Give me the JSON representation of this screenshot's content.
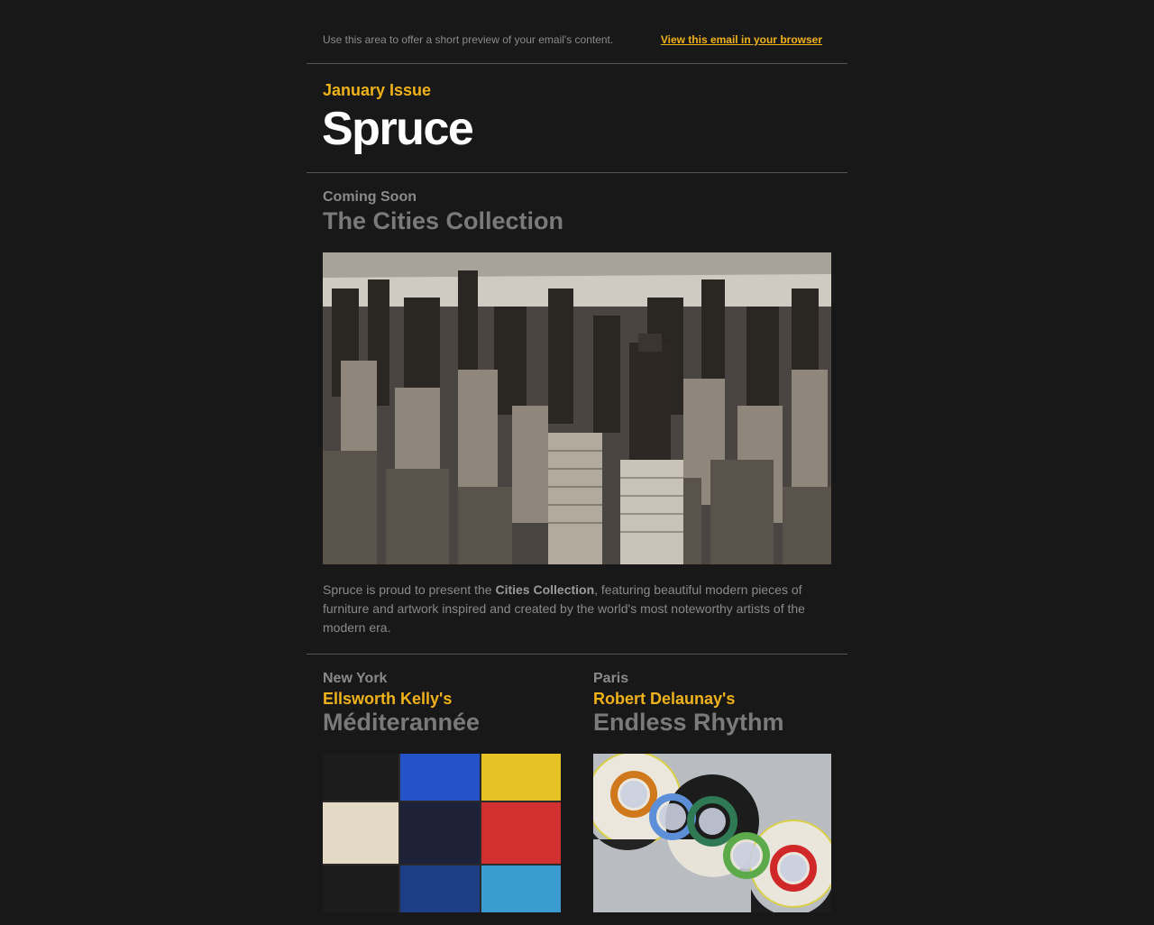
{
  "preheader": {
    "text": "Use this area to offer a short preview of your email's content.",
    "browser_link": "View this email in your browser"
  },
  "header": {
    "issue": "January Issue",
    "brand": "Spruce"
  },
  "feature": {
    "kicker": "Coming Soon",
    "title": "The Cities Collection",
    "body_before": "Spruce is proud to present the ",
    "body_bold": "Cities Collection",
    "body_after": ", featuring beautiful modern pieces of furniture and artwork inspired and created by the world's most noteworthy artists of the modern era."
  },
  "columns": [
    {
      "city": "New York",
      "artist": "Ellsworth Kelly's",
      "work": "Méditerannée"
    },
    {
      "city": "Paris",
      "artist": "Robert Delaunay's",
      "work": "Endless Rhythm"
    }
  ],
  "colors": {
    "background": "#181818",
    "accent": "#f0b21a",
    "muted_text": "#8a8a8a",
    "divider": "#555555"
  }
}
